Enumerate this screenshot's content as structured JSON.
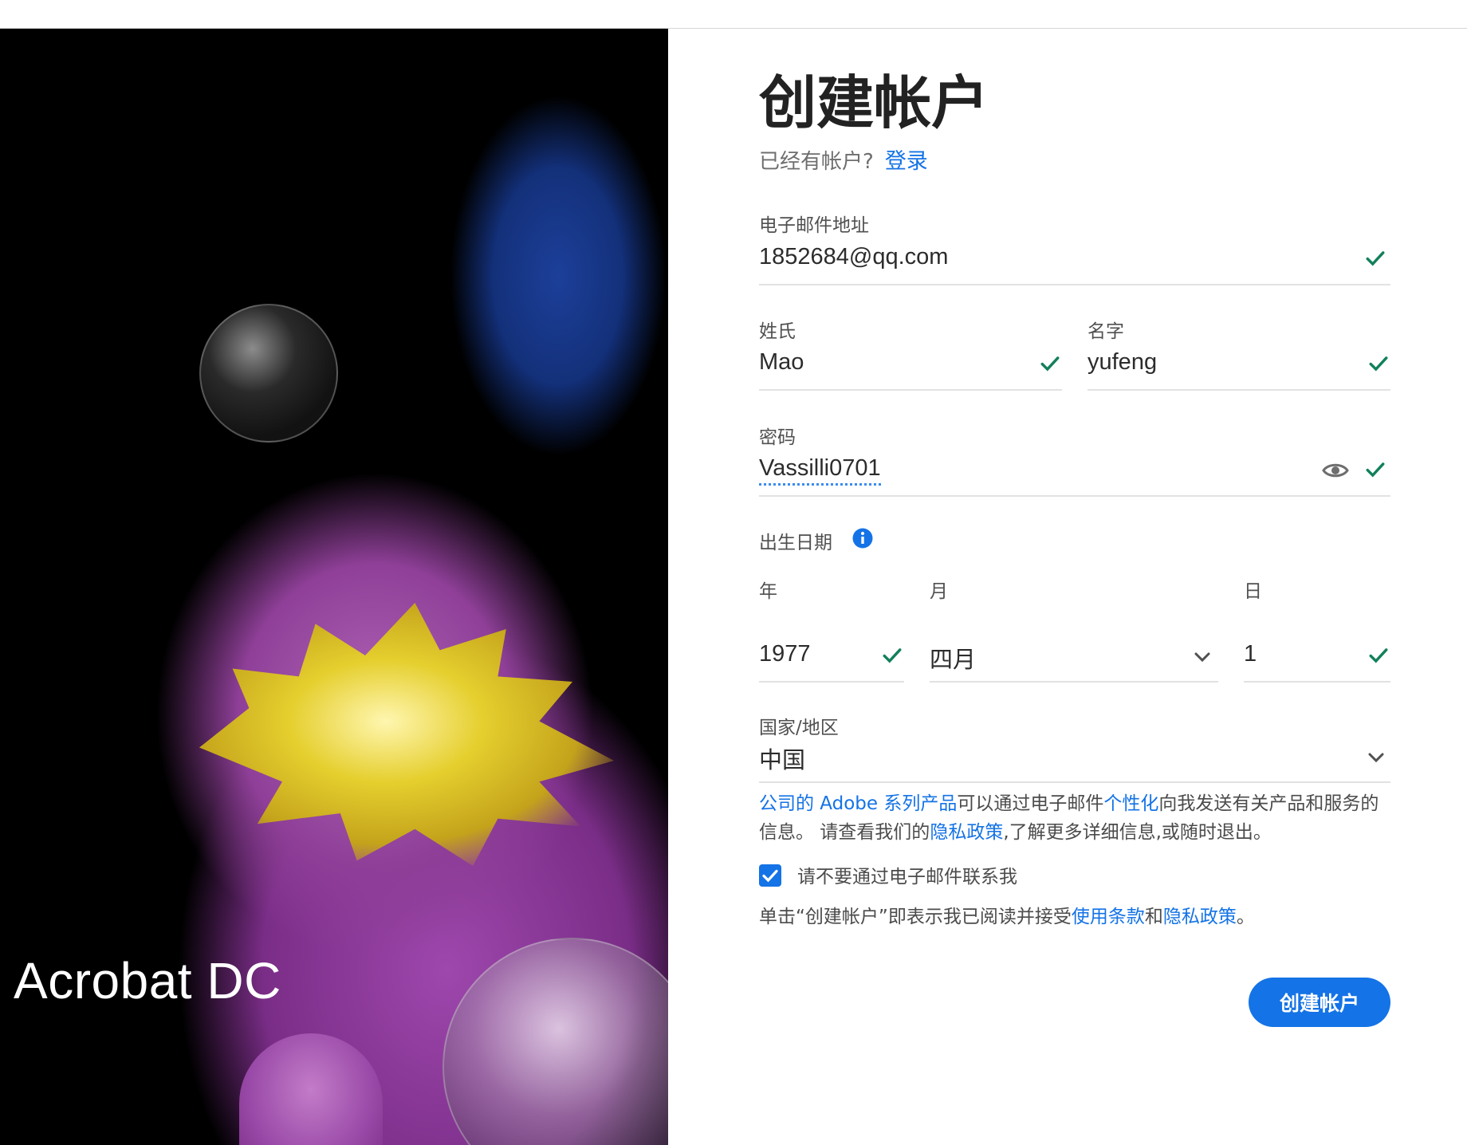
{
  "brand": {
    "product_name": "Acrobat DC",
    "accent": "#1473e6",
    "valid": "#12805c"
  },
  "form": {
    "title": "创建帐户",
    "already_have_account": "已经有帐户?",
    "signin_link": "登录",
    "email": {
      "label": "电子邮件地址",
      "value": "1852684@qq.com"
    },
    "last_name": {
      "label": "姓氏",
      "value": "Mao"
    },
    "first_name": {
      "label": "名字",
      "value": "yufeng"
    },
    "password": {
      "label": "密码",
      "value": "Vassilli0701",
      "visibility_icon": "eye-icon"
    },
    "dob": {
      "label": "出生日期",
      "year": {
        "label": "年",
        "value": "1977"
      },
      "month": {
        "label": "月",
        "value": "四月"
      },
      "day": {
        "label": "日",
        "value": "1"
      }
    },
    "country": {
      "label": "国家/地区",
      "value": "中国"
    },
    "consent": {
      "part1_link": "公司的 Adobe 系列产品",
      "part2": "可以通过电子邮件",
      "part3_link": "个性化",
      "part4": "向我发送有关产品和服务的信息。 请查看我们的",
      "part5_link": "隐私政策",
      "part6": ",了解更多详细信息,或随时退出。"
    },
    "no_email_checkbox": {
      "label": "请不要通过电子邮件联系我",
      "checked": true
    },
    "terms": {
      "part1": "单击“创建帐户”即表示我已阅读并接受",
      "terms_link": "使用条款",
      "and": "和",
      "privacy_link": "隐私政策",
      "end": "。"
    },
    "submit_label": "创建帐户"
  }
}
